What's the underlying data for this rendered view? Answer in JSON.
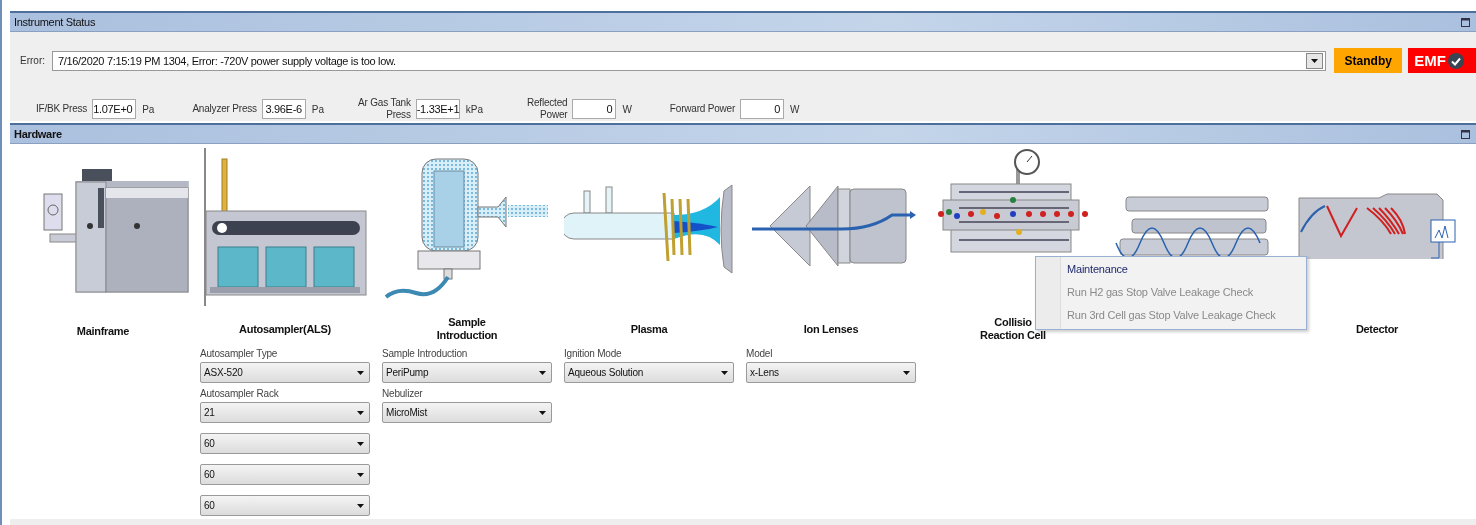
{
  "instrument_status": {
    "title": "Instrument Status",
    "error_label": "Error:",
    "error_message": "7/16/2020 7:15:19 PM 1304, Error: -720V power supply voltage is too low.",
    "standby_button": "Standby",
    "emf_button": "EMF",
    "readings": [
      {
        "label": [
          "IF/BK Press"
        ],
        "value": "1.07E+0",
        "unit": "Pa"
      },
      {
        "label": [
          "Analyzer Press"
        ],
        "value": "3.96E-6",
        "unit": "Pa"
      },
      {
        "label": [
          "Ar Gas Tank",
          "Press"
        ],
        "value": "-1.33E+1",
        "unit": "kPa"
      },
      {
        "label": [
          "Reflected",
          "Power"
        ],
        "value": "0",
        "unit": "W"
      },
      {
        "label": [
          "Forward Power"
        ],
        "value": "0",
        "unit": "W"
      }
    ]
  },
  "hardware": {
    "title": "Hardware",
    "items": [
      {
        "kind": "mainframe",
        "label": [
          "Mainframe"
        ]
      },
      {
        "kind": "autosampler",
        "label": [
          "Autosampler(ALS)"
        ],
        "fields": [
          {
            "label": "Autosampler Type",
            "value": "ASX-520"
          },
          {
            "label": "Autosampler Rack",
            "value": "21"
          },
          {
            "value": "60"
          },
          {
            "value": "60"
          },
          {
            "value": "60"
          }
        ]
      },
      {
        "kind": "nebulizer",
        "label": [
          "Sample",
          "Introduction"
        ],
        "fields": [
          {
            "label": "Sample Introduction",
            "value": "PeriPump"
          },
          {
            "label": "Nebulizer",
            "value": "MicroMist"
          }
        ]
      },
      {
        "kind": "plasma",
        "label": [
          "Plasma"
        ],
        "fields": [
          {
            "label": "Ignition Mode",
            "value": "Aqueous Solution"
          }
        ]
      },
      {
        "kind": "lenses",
        "label": [
          "Ion Lenses"
        ],
        "fields": [
          {
            "label": "Model",
            "value": "x-Lens"
          }
        ]
      },
      {
        "kind": "cell",
        "label": [
          "Collisio",
          "Reaction Cell"
        ]
      },
      {
        "kind": "quadrupole"
      },
      {
        "kind": "detector",
        "label": [
          "Detector"
        ]
      }
    ],
    "context_menu": [
      {
        "label": "Maintenance",
        "disabled": false
      },
      {
        "label": "Run H2 gas Stop Valve Leakage Check",
        "disabled": true
      },
      {
        "label": "Run 3rd Cell gas Stop Valve Leakage Check",
        "disabled": true
      }
    ]
  }
}
